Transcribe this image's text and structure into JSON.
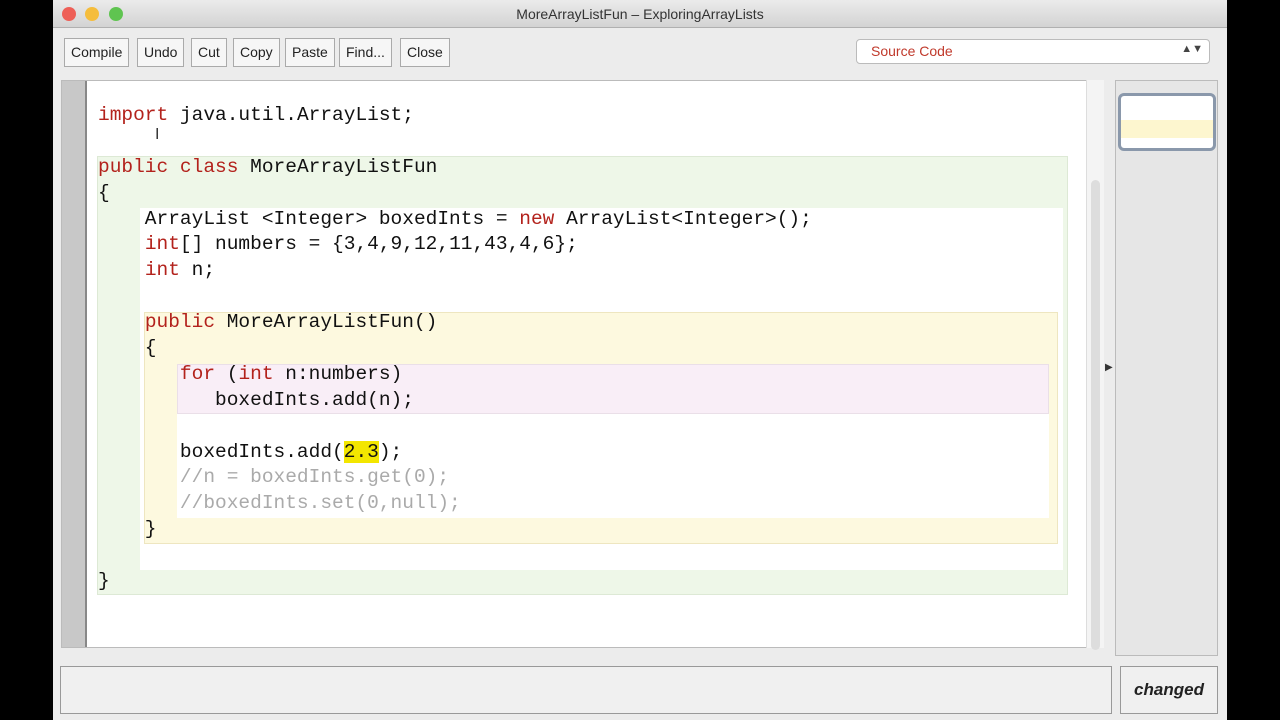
{
  "window": {
    "title": "MoreArrayListFun – ExploringArrayLists"
  },
  "toolbar": {
    "compile": "Compile",
    "undo": "Undo",
    "cut": "Cut",
    "copy": "Copy",
    "paste": "Paste",
    "find": "Find...",
    "close": "Close"
  },
  "view_select": {
    "value": "Source Code"
  },
  "status": {
    "text": "",
    "state": "changed"
  },
  "code_lines": [
    [
      [
        "import",
        "kw"
      ],
      [
        " java.util.ArrayList;",
        ""
      ]
    ],
    [],
    [
      [
        "public",
        "kw"
      ],
      [
        " ",
        ""
      ],
      [
        "class",
        "kw"
      ],
      [
        " MoreArrayListFun",
        ""
      ]
    ],
    [
      [
        "{",
        ""
      ]
    ],
    [
      [
        "    ArrayList <Integer> boxedInts = ",
        ""
      ],
      [
        "new",
        "kw"
      ],
      [
        " ArrayList<Integer>();",
        ""
      ]
    ],
    [
      [
        "    ",
        ""
      ],
      [
        "int",
        "kw"
      ],
      [
        "[] numbers = {3,4,9,12,11,43,4,6};",
        ""
      ]
    ],
    [
      [
        "    ",
        ""
      ],
      [
        "int",
        "kw"
      ],
      [
        " n;",
        ""
      ]
    ],
    [],
    [
      [
        "    ",
        ""
      ],
      [
        "public",
        "kw"
      ],
      [
        " MoreArrayListFun()",
        ""
      ]
    ],
    [
      [
        "    {",
        ""
      ]
    ],
    [
      [
        "       ",
        ""
      ],
      [
        "for",
        "kw"
      ],
      [
        " (",
        ""
      ],
      [
        "int",
        "kw"
      ],
      [
        " n:numbers)",
        ""
      ]
    ],
    [
      [
        "          boxedInts.add(n);",
        ""
      ]
    ],
    [],
    [
      [
        "       boxedInts.add(",
        ""
      ],
      [
        "2.3",
        "hl"
      ],
      [
        ");",
        ""
      ]
    ],
    [
      [
        "       //n = boxedInts.get(0);",
        "cm"
      ]
    ],
    [
      [
        "       //boxedInts.set(0,null);",
        "cm"
      ]
    ],
    [
      [
        "    }",
        ""
      ]
    ],
    [],
    [
      [
        "}",
        ""
      ]
    ]
  ]
}
